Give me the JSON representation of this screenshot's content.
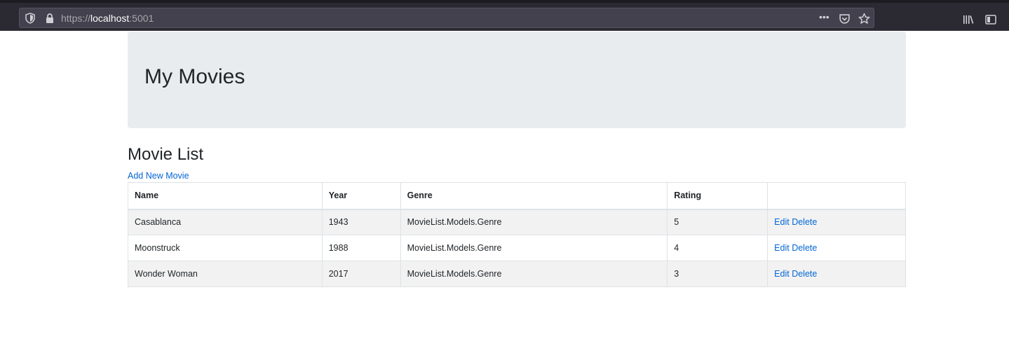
{
  "browser": {
    "url_scheme": "https://",
    "url_host": "localhost",
    "url_port": ":5001",
    "menu_dots": "•••"
  },
  "page": {
    "heading": "My Movies",
    "section_title": "Movie List",
    "add_link_label": "Add New Movie"
  },
  "table": {
    "columns": [
      "Name",
      "Year",
      "Genre",
      "Rating",
      ""
    ],
    "rows": [
      {
        "name": "Casablanca",
        "year": "1943",
        "genre": "MovieList.Models.Genre",
        "rating": "5",
        "edit": "Edit",
        "delete": "Delete"
      },
      {
        "name": "Moonstruck",
        "year": "1988",
        "genre": "MovieList.Models.Genre",
        "rating": "4",
        "edit": "Edit",
        "delete": "Delete"
      },
      {
        "name": "Wonder Woman",
        "year": "2017",
        "genre": "MovieList.Models.Genre",
        "rating": "3",
        "edit": "Edit",
        "delete": "Delete"
      }
    ]
  },
  "colors": {
    "link": "#0366d6",
    "jumbotron_bg": "#e9ecef",
    "browser_bg": "#2b2a33"
  },
  "icons": [
    "shield-icon",
    "lock-icon",
    "more-icon",
    "pocket-icon",
    "star-icon",
    "library-icon",
    "sidebar-icon"
  ]
}
